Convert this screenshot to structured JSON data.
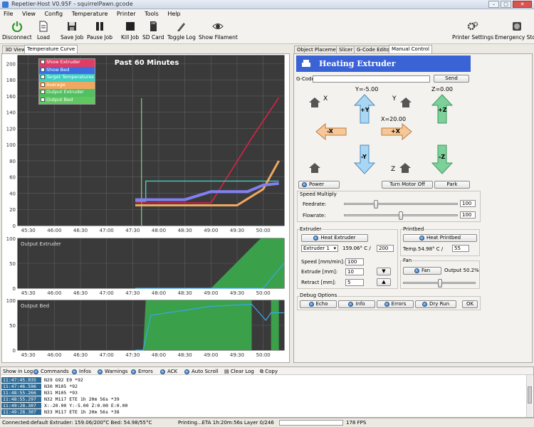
{
  "window": {
    "title": "Repetier-Host V0.95F - squirrelPawn.gcode",
    "min": "–",
    "max": "□",
    "close": "✕"
  },
  "menu": [
    "File",
    "View",
    "Config",
    "Temperature",
    "Printer",
    "Tools",
    "Help"
  ],
  "toolbar": {
    "connect": "Disconnect",
    "load": "Load",
    "save_job": "Save Job",
    "pause_job": "Pause Job",
    "kill_job": "Kill Job",
    "sd_card": "SD Card",
    "toggle_log": "Toggle Log",
    "show_filament": "Show Filament",
    "printer_settings": "Printer Settings",
    "emergency_stop": "Emergency Stop"
  },
  "left_tabs": [
    "3D View",
    "Temperature Curve"
  ],
  "temp_chart": {
    "title": "Past 60 Minutes",
    "legend": [
      {
        "label": "Show Extruder",
        "color": "#e23c64"
      },
      {
        "label": "Show Bed",
        "color": "#3c6fe2"
      },
      {
        "label": "Target Temperatures",
        "color": "#40d0c0"
      },
      {
        "label": "Average",
        "color": "#f0a860"
      },
      {
        "label": "Output Extruder",
        "color": "#50c060"
      },
      {
        "label": "Output Bed",
        "color": "#60c860"
      }
    ],
    "x_ticks": [
      "45:30",
      "46:00",
      "46:30",
      "47:00",
      "47:30",
      "48:00",
      "48:30",
      "49:00",
      "49:30",
      "50:00"
    ],
    "y_ticks": [
      "0",
      "20",
      "40",
      "60",
      "80",
      "100",
      "120",
      "140",
      "160",
      "180",
      "200"
    ],
    "sub_y_ticks": [
      "0",
      "50",
      "100"
    ],
    "output_extruder_label": "Output Extruder",
    "output_bed_label": "Output Bed"
  },
  "chart_data": {
    "type": "line",
    "title": "Past 60 Minutes",
    "x_ticks": [
      "45:30",
      "46:00",
      "46:30",
      "47:00",
      "47:30",
      "48:00",
      "48:30",
      "49:00",
      "49:30",
      "50:00"
    ],
    "ylim": [
      0,
      210
    ],
    "series": [
      {
        "name": "Show Extruder",
        "color": "#e8204a",
        "points": [
          [
            47.55,
            28
          ],
          [
            49.0,
            28
          ],
          [
            49.8,
            110
          ],
          [
            50.3,
            158
          ]
        ]
      },
      {
        "name": "Target Temperatures",
        "color": "#40d0c0",
        "points": [
          [
            47.55,
            30
          ],
          [
            47.75,
            30
          ],
          [
            47.75,
            55
          ],
          [
            50.3,
            55
          ]
        ]
      },
      {
        "name": "Average",
        "color": "#f0a860",
        "points": [
          [
            47.55,
            25
          ],
          [
            49.5,
            25
          ],
          [
            50.0,
            45
          ],
          [
            50.3,
            80
          ]
        ]
      },
      {
        "name": "Show Bed",
        "color": "#8080f0",
        "points": [
          [
            47.55,
            32
          ],
          [
            48.5,
            32
          ],
          [
            49.0,
            42
          ],
          [
            49.7,
            42
          ],
          [
            50.0,
            50
          ],
          [
            50.3,
            52
          ]
        ]
      }
    ]
  },
  "right_tabs": [
    "Object Placement",
    "Slicer",
    "G-Code Editor",
    "Manual Control"
  ],
  "manual": {
    "header": "Heating Extruder",
    "gcode_label": "G-Code:",
    "send": "Send",
    "x_label": "X",
    "y_label": "Y",
    "z_label": "Z",
    "y_value": "Y=-5.00",
    "z_value": "Z=0.00",
    "x_value": "X=20.00",
    "plus_y": "+Y",
    "minus_y": "-Y",
    "plus_x": "+X",
    "minus_x": "-X",
    "plus_z": "+Z",
    "minus_z": "-Z",
    "power": "Power",
    "turn_motor_off": "Turn Motor Off",
    "park": "Park",
    "speed_multiply": "Speed Multiply",
    "feedrate_label": "Feedrate:",
    "feedrate_value": "100",
    "flowrate_label": "Flowrate:",
    "flowrate_value": "100",
    "extruder_group": "Extruder",
    "heat_extruder": "Heat Extruder",
    "extruder_select": "Extruder 1",
    "extruder_temp": "159.06° C /",
    "extruder_target": "200",
    "speed_label": "Speed [mm/min]:",
    "speed_value": "100",
    "extrude_label": "Extrude [mm]:",
    "extrude_value": "10",
    "retract_label": "Retract [mm]:",
    "retract_value": "5",
    "printbed_group": "Printbed",
    "heat_printbed": "Heat Printbed",
    "bed_temp_label": "Temp.",
    "bed_temp": "54.98° C /",
    "bed_target": "55",
    "fan_group": "Fan",
    "fan": "Fan",
    "fan_output": "Output 50.2%",
    "debug_group": "Debug Options",
    "echo": "Echo",
    "info": "Info",
    "errors": "Errors",
    "dry_run": "Dry Run",
    "ok": "OK"
  },
  "log_toolbar": [
    "Show in Log:",
    "Commands",
    "Infos",
    "Warnings",
    "Errors",
    "ACK",
    "Auto Scroll",
    "Clear Log",
    "Copy"
  ],
  "log": [
    {
      "time": "11:47:45.035",
      "msg": "N29 G92 E0 *92"
    },
    {
      "time": "11:47:46.596",
      "msg": "N30 M105 *92"
    },
    {
      "time": "11:48:55.266",
      "msg": "N31 M105 *93"
    },
    {
      "time": "11:48:55.297",
      "msg": "N32 M117 ETE 1h 20m 56s *39"
    },
    {
      "time": "11:49:28.307",
      "msg": "X:-20.00 Y:-5.00 Z:0.00 E:0.00"
    },
    {
      "time": "11:49:28.307",
      "msg": "N33 M117 ETE 1h 20m 56s *38"
    }
  ],
  "status": {
    "connection": "Connected:default",
    "temps": "Extruder: 159.06/200°C Bed: 54.98/55°C",
    "printing": "Printing...ETA 1h:20m:56s Layer 0/246",
    "fps": "178 FPS"
  }
}
